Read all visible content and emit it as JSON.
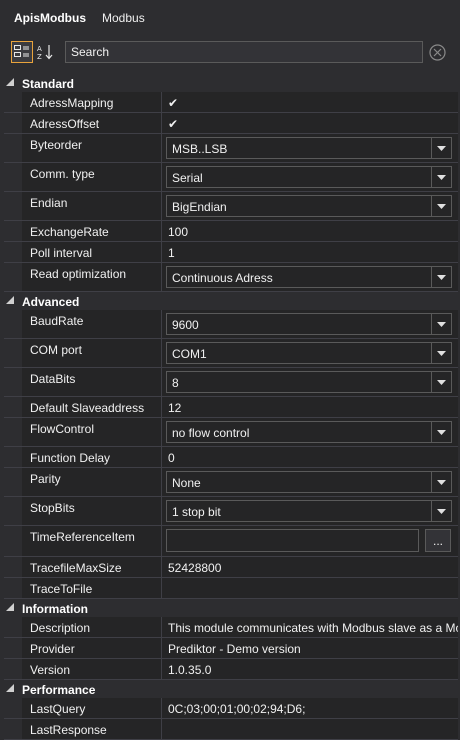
{
  "header": {
    "title": "ApisModbus",
    "subtitle": "Modbus"
  },
  "toolbar": {
    "search_placeholder": "Search"
  },
  "categories": {
    "standard": {
      "label": "Standard",
      "props": {
        "adress_mapping": {
          "name": "AdressMapping",
          "value": "✔"
        },
        "adress_offset": {
          "name": "AdressOffset",
          "value": "✔"
        },
        "byteorder": {
          "name": "Byteorder",
          "value": "MSB..LSB"
        },
        "comm_type": {
          "name": "Comm. type",
          "value": "Serial"
        },
        "endian": {
          "name": "Endian",
          "value": "BigEndian"
        },
        "exchange_rate": {
          "name": "ExchangeRate",
          "value": "100"
        },
        "poll_interval": {
          "name": "Poll interval",
          "value": "1"
        },
        "read_optimization": {
          "name": "Read optimization",
          "value": "Continuous  Adress"
        }
      }
    },
    "advanced": {
      "label": "Advanced",
      "props": {
        "baud_rate": {
          "name": "BaudRate",
          "value": "9600"
        },
        "com_port": {
          "name": "COM port",
          "value": "COM1"
        },
        "data_bits": {
          "name": "DataBits",
          "value": "8"
        },
        "default_slave": {
          "name": "Default Slaveaddress",
          "value": "12"
        },
        "flow_control": {
          "name": "FlowControl",
          "value": "no flow control"
        },
        "function_delay": {
          "name": "Function Delay",
          "value": "0"
        },
        "parity": {
          "name": "Parity",
          "value": "None"
        },
        "stop_bits": {
          "name": "StopBits",
          "value": "1 stop bit"
        },
        "time_ref": {
          "name": "TimeReferenceItem",
          "value": "",
          "button": "..."
        },
        "tracefile_max": {
          "name": "TracefileMaxSize",
          "value": "52428800"
        },
        "trace_to_file": {
          "name": "TraceToFile",
          "value": ""
        }
      }
    },
    "information": {
      "label": "Information",
      "props": {
        "description": {
          "name": "Description",
          "value": "This module communicates with Modbus slave as a Mo"
        },
        "provider": {
          "name": "Provider",
          "value": "Prediktor - Demo version"
        },
        "version": {
          "name": "Version",
          "value": "1.0.35.0"
        }
      }
    },
    "performance": {
      "label": "Performance",
      "props": {
        "last_query": {
          "name": "LastQuery",
          "value": "0C;03;00;01;00;02;94;D6;"
        },
        "last_response": {
          "name": "LastResponse",
          "value": ""
        }
      }
    }
  },
  "colors": {
    "background": "#252526",
    "chrome": "#2d2d30",
    "border": "#3f3f46",
    "accent": "#e8a33c",
    "text": "#f1f1f1"
  },
  "icons": {
    "categorized": "categorized-view-icon",
    "alphabetical": "sort-alphabetical-icon",
    "clear": "clear-search-icon",
    "expand": "expanded-triangle-icon",
    "dropdown": "dropdown-arrow-icon"
  }
}
